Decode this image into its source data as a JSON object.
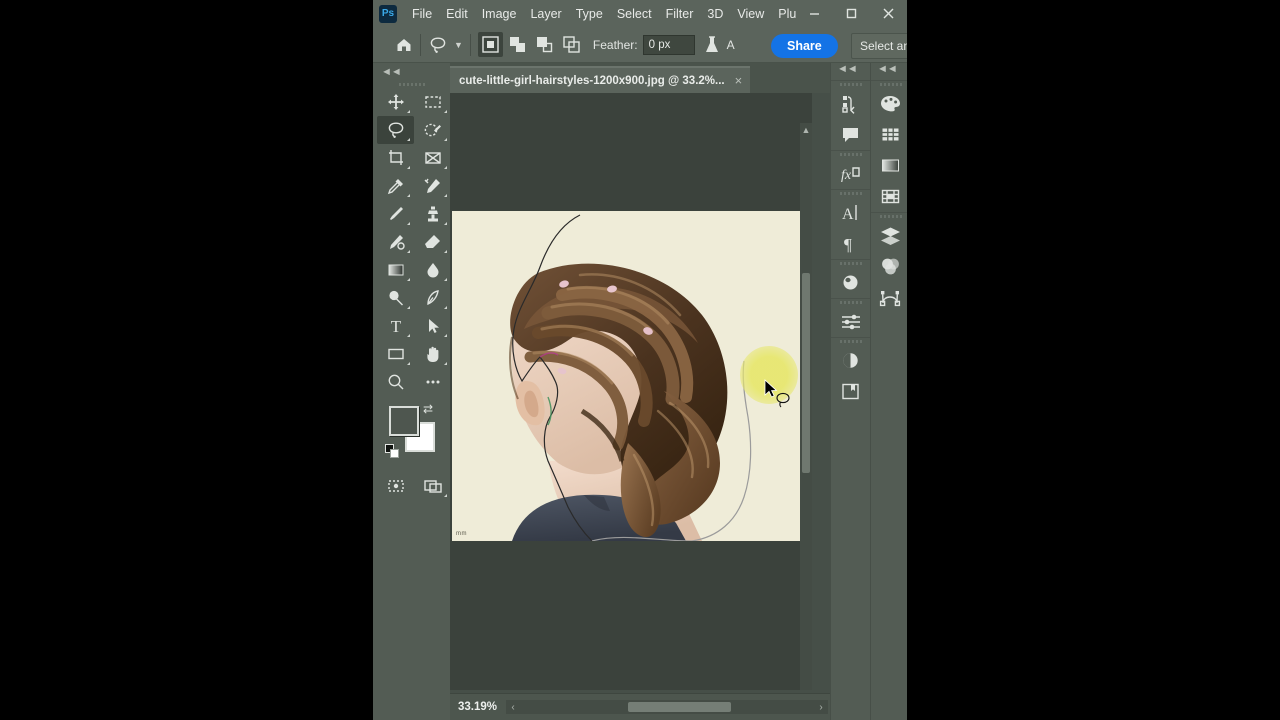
{
  "app": {
    "name": "Adobe Photoshop",
    "logo_text": "Ps",
    "accent_blue": "#1473e6",
    "chrome_bg": "#5b645c",
    "panel_bg": "#535c54",
    "canvas_bg": "#3b423c"
  },
  "menubar": {
    "items": [
      {
        "label": "File"
      },
      {
        "label": "Edit"
      },
      {
        "label": "Image"
      },
      {
        "label": "Layer"
      },
      {
        "label": "Type"
      },
      {
        "label": "Select"
      },
      {
        "label": "Filter"
      },
      {
        "label": "3D"
      },
      {
        "label": "View"
      },
      {
        "label": "Plu"
      }
    ],
    "window_controls": [
      "minimize",
      "maximize",
      "close"
    ]
  },
  "options_bar": {
    "home_icon": "home-icon",
    "tool_preset_icon": "lasso-icon",
    "tool_preset_caret": "chevron-down-icon",
    "selection_modes": [
      {
        "name": "new-selection",
        "active": true
      },
      {
        "name": "add-to-selection",
        "active": false
      },
      {
        "name": "subtract-from-selection",
        "active": false
      },
      {
        "name": "intersect-with-selection",
        "active": false
      }
    ],
    "feather_label": "Feather:",
    "feather_value": "0 px",
    "refine_edge_icon": "flask-icon",
    "antialias_label": "A",
    "share_label": "Share",
    "select_and_mask_label": "Select and M"
  },
  "toolbar": {
    "collapse_icon": "double-chevron-left-icon",
    "tools": [
      {
        "name": "move-tool",
        "active": false
      },
      {
        "name": "rectangular-marquee-tool",
        "active": false
      },
      {
        "name": "lasso-tool",
        "active": true
      },
      {
        "name": "quick-selection-tool",
        "active": false
      },
      {
        "name": "crop-tool",
        "active": false
      },
      {
        "name": "frame-tool",
        "active": false
      },
      {
        "name": "eyedropper-tool",
        "active": false
      },
      {
        "name": "spot-healing-brush-tool",
        "active": false
      },
      {
        "name": "brush-tool",
        "active": false
      },
      {
        "name": "clone-stamp-tool",
        "active": false
      },
      {
        "name": "history-brush-tool",
        "active": false
      },
      {
        "name": "eraser-tool",
        "active": false
      },
      {
        "name": "gradient-tool",
        "active": false
      },
      {
        "name": "blur-tool",
        "active": false
      },
      {
        "name": "dodge-tool",
        "active": false
      },
      {
        "name": "pen-tool",
        "active": false
      },
      {
        "name": "type-tool",
        "active": false
      },
      {
        "name": "path-selection-tool",
        "active": false
      },
      {
        "name": "rectangle-tool",
        "active": false
      },
      {
        "name": "hand-tool",
        "active": false
      },
      {
        "name": "zoom-tool",
        "active": false
      },
      {
        "name": "edit-toolbar-tool",
        "active": false
      }
    ],
    "foreground_color": "#4e564f",
    "background_color": "#ffffff",
    "swap_colors_icon": "swap-arrow-icon",
    "default_colors_icon": "default-colors-icon",
    "quick_mask_icon": "quick-mask-icon",
    "screen_mode_icon": "screen-mode-icon"
  },
  "document": {
    "tab_title": "cute-little-girl-hairstyles-1200x900.jpg @ 33.2%...",
    "tab_close_icon": "close-icon",
    "watermark_text": "mm",
    "image_description": "Photo of a girl seen from behind with braided hairstyle on cream background",
    "lasso_selection_active": true,
    "highlight_color": "#e7e770",
    "cursor_icon": "arrow-cursor-icon",
    "cursor_tool_icon": "lasso-cursor-icon"
  },
  "statusbar": {
    "zoom_level": "33.19%",
    "scroll_left_icon": "chevron-left-icon",
    "scroll_right_icon": "chevron-right-icon"
  },
  "right_rail_a": {
    "collapse_icon": "double-chevron-left-icon",
    "groups": [
      {
        "items": [
          {
            "name": "history-panel-icon"
          },
          {
            "name": "notes-panel-icon"
          }
        ]
      },
      {
        "items": [
          {
            "name": "styles-panel-icon"
          }
        ]
      },
      {
        "items": [
          {
            "name": "character-panel-icon"
          },
          {
            "name": "paragraph-panel-icon"
          }
        ]
      },
      {
        "items": [
          {
            "name": "3d-panel-icon"
          }
        ]
      },
      {
        "items": [
          {
            "name": "properties-panel-icon"
          }
        ]
      },
      {
        "items": [
          {
            "name": "adjustments-panel-icon"
          },
          {
            "name": "libraries-panel-icon"
          }
        ]
      }
    ]
  },
  "right_rail_b": {
    "collapse_icon": "double-chevron-left-icon",
    "groups": [
      {
        "items": [
          {
            "name": "color-panel-icon"
          },
          {
            "name": "swatches-panel-icon"
          },
          {
            "name": "gradients-panel-icon"
          },
          {
            "name": "patterns-panel-icon"
          }
        ]
      },
      {
        "items": [
          {
            "name": "layers-panel-icon"
          },
          {
            "name": "channels-panel-icon"
          },
          {
            "name": "paths-panel-icon"
          }
        ]
      }
    ]
  }
}
